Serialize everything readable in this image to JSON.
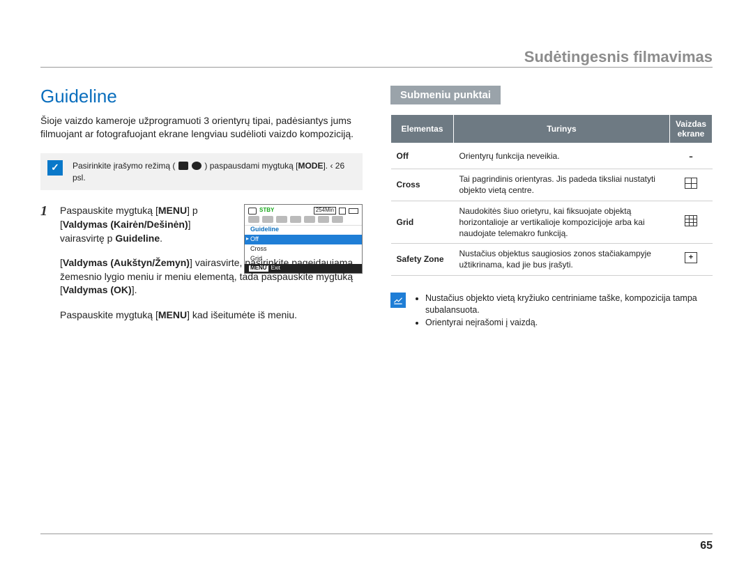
{
  "header": {
    "section_title": "Sudėtingesnis filmavimas"
  },
  "left": {
    "title": "Guideline",
    "intro": "Šioje vaizdo kameroje užprogramuoti 3 orientyrų tipai, padėsiantys jums filmuojant ar fotografuojant ekrane lengviau sudėlioti vaizdo kompoziciją.",
    "tip_prefix": "Pasirinkite įrašymo režimą (",
    "tip_mid": ") paspausdami mygtuką [",
    "tip_mode": "MODE",
    "tip_suffix": "].  ‹  26 psl.",
    "steps": [
      {
        "num": "1",
        "parts": [
          "Paspauskite mygtuką [",
          "MENU",
          "]  p [",
          "Valdymas (Kairėn/Dešinėn)",
          "] vairasvirtę  p ",
          "Guideline",
          "."
        ]
      },
      {
        "num": "",
        "parts": [
          "[",
          "Valdymas (Aukštyn/Žemyn)",
          "] vairasvirte, pasirinkite pageidaujamą žemesnio lygio meniu ir meniu elementą, tada paspauskite mygtuką [",
          "Valdymas (OK)",
          "]."
        ]
      },
      {
        "num": "",
        "parts": [
          "Paspauskite mygtuką [",
          "MENU",
          "] kad išeitumėte iš meniu."
        ]
      }
    ],
    "lcd": {
      "stby": "STBY",
      "time": "254Min",
      "menu_title": "Guideline",
      "rows": [
        "Off",
        "Cross",
        "Grid"
      ],
      "selected_index": 0,
      "exit_tag": "MENU",
      "exit_label": "Exit"
    }
  },
  "right": {
    "subhead": "Submeniu punktai",
    "table": {
      "headers": [
        "Elementas",
        "Turinys",
        "Vaizdas ekrane"
      ],
      "rows": [
        {
          "elem": "Off",
          "turinys": "Orientyrų funkcija neveikia.",
          "icon": "-"
        },
        {
          "elem": "Cross",
          "turinys": "Tai pagrindinis orientyras. Jis padeda tiksliai nustatyti objekto vietą centre.",
          "icon": "2x2"
        },
        {
          "elem": "Grid",
          "turinys": "Naudokitės šiuo orietyru, kai fiksuojate objektą horizontalioje ar vertikalioje kompozicijoje arba kai naudojate telemakro funkciją.",
          "icon": "3x3"
        },
        {
          "elem": "Safety Zone",
          "turinys": "Nustačius objektus saugiosios zonos stačiakampyje užtikrinama, kad jie bus įrašyti.",
          "icon": "sz"
        }
      ]
    },
    "notes": [
      "Nustačius objekto vietą kryžiuko centriniame taške, kompozicija tampa subalansuota.",
      "Orientyrai neįrašomi į vaizdą."
    ]
  },
  "page_number": "65"
}
